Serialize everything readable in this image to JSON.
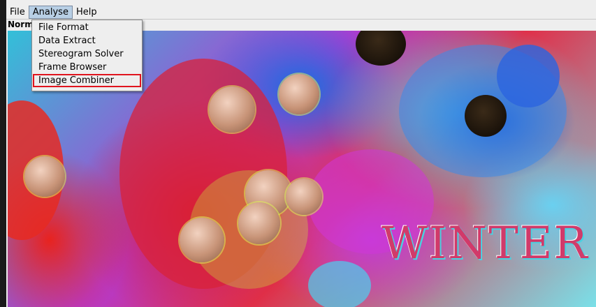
{
  "menubar": {
    "items": [
      {
        "label": "File"
      },
      {
        "label": "Analyse",
        "open": true
      },
      {
        "label": "Help"
      }
    ]
  },
  "status": {
    "mode_label": "Norm"
  },
  "analyse_menu": {
    "items": [
      {
        "label": "File Format"
      },
      {
        "label": "Data Extract"
      },
      {
        "label": "Stereogram Solver"
      },
      {
        "label": "Frame Browser"
      },
      {
        "label": "Image Combiner",
        "highlighted": true
      }
    ]
  },
  "image": {
    "visible_text": "WINTER"
  },
  "colors": {
    "menu_open_bg": "#b8cfe5",
    "highlight_outline": "#e0141e"
  }
}
